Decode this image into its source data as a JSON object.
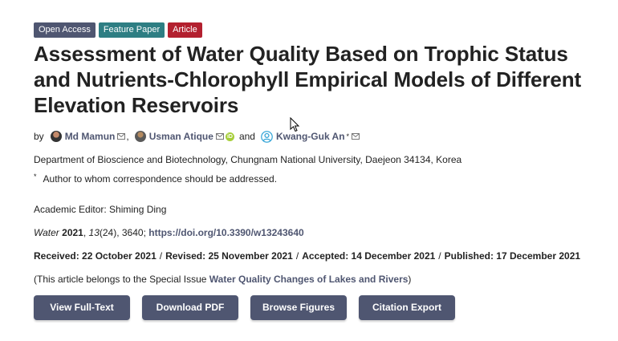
{
  "badges": [
    "Open Access",
    "Feature Paper",
    "Article"
  ],
  "title": "Assessment of Water Quality Based on Trophic Status and Nutrients-Chlorophyll Empirical Models of Different Elevation Reservoirs",
  "authors": {
    "by": "by",
    "names": [
      "Md Mamun",
      "Usman Atique",
      "Kwang-Guk An"
    ],
    "comma": ",",
    "and": "and",
    "corr_mark": "*"
  },
  "affiliation": "Department of Bioscience and Biotechnology, Chungnam National University, Daejeon 34134, Korea",
  "correspondence": {
    "mark": "*",
    "text": "Author to whom correspondence should be addressed."
  },
  "editor": "Academic Editor: Shiming Ding",
  "citation": {
    "journal": "Water",
    "year": "2021",
    "volume": "13",
    "issue": "(24)",
    "pages": ", 3640; ",
    "doi": "https://doi.org/10.3390/w13243640"
  },
  "dates": {
    "received": "Received: 22 October 2021",
    "revised": "Revised: 25 November 2021",
    "accepted": "Accepted: 14 December 2021",
    "published": "Published: 17 December 2021",
    "separator": "/"
  },
  "special_issue": {
    "prefix": "(This article belongs to the Special Issue ",
    "name": "Water Quality Changes of Lakes and Rivers",
    "suffix": ")"
  },
  "buttons": [
    "View Full-Text",
    "Download PDF",
    "Browse Figures",
    "Citation Export"
  ],
  "colors": {
    "primary": "#4f5671",
    "feature_paper": "#2e7e83",
    "article": "#b3202f",
    "orcid": "#a6ce39"
  },
  "icons": {
    "mail": "envelope-icon",
    "orcid": "orcid-icon",
    "cursor": "mouse-pointer-icon"
  }
}
